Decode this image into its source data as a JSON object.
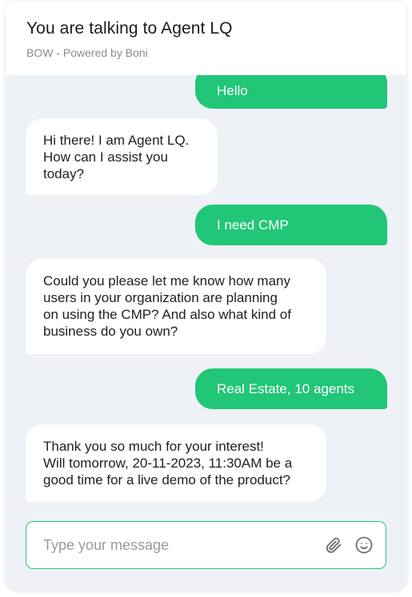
{
  "header": {
    "title": "You are talking to Agent LQ",
    "subtitle": "BOW - Powered by Boni"
  },
  "messages": [
    {
      "sender": "user",
      "text": "Hello"
    },
    {
      "sender": "agent",
      "text": "Hi there! I am Agent LQ.\nHow can I assist you\ntoday?"
    },
    {
      "sender": "user",
      "text": "I need CMP"
    },
    {
      "sender": "agent",
      "text": "Could you please let me know how many\nusers in your organization are planning\non using the CMP? And also what kind of\nbusiness do you own?"
    },
    {
      "sender": "user",
      "text": "Real Estate, 10 agents"
    },
    {
      "sender": "agent",
      "text": "Thank you so much for your interest!\nWill tomorrow, 20-11-2023, 11:30AM be a\ngood time for a live demo of the product?"
    }
  ],
  "composer": {
    "placeholder": "Type your message",
    "attach_icon": "paperclip-icon",
    "emoji_icon": "smiley-icon"
  },
  "colors": {
    "user_bubble": "#21c677",
    "agent_bubble": "#ffffff",
    "chat_background": "#eef2f6",
    "composer_border": "#2fc47b"
  }
}
